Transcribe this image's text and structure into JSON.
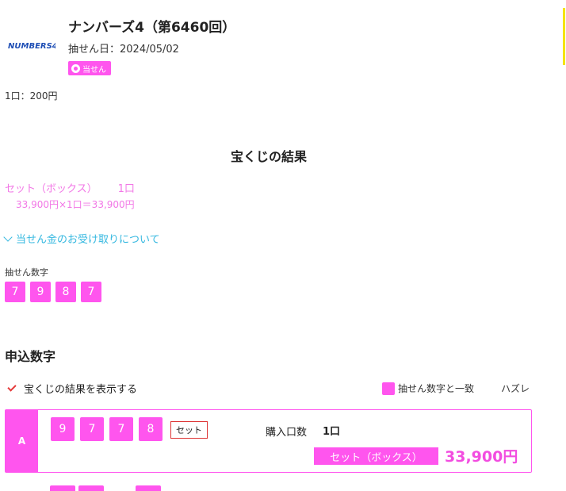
{
  "header": {
    "logo_text": "NUMBERS4",
    "title": "ナンバーズ4（第6460回）",
    "draw_date": "抽せん日：2024/05/02",
    "badge": "当せん"
  },
  "unit_price": "1口：200円",
  "result": {
    "heading": "宝くじの結果",
    "prize_type": "セット（ボックス）",
    "prize_count": "1口",
    "prize_calc": "33,900円×1口＝33,900円",
    "prize_link": "当せん金のお受け取りについて"
  },
  "winning": {
    "label": "抽せん数字",
    "digits": [
      "7",
      "9",
      "8",
      "7"
    ]
  },
  "applied": {
    "heading": "申込数字",
    "toggle_label": "宝くじの結果を表示する",
    "legend_match": "抽せん数字と一致",
    "legend_miss": "ハズレ"
  },
  "tickets": [
    {
      "label": "A",
      "digits": [
        "9",
        "7",
        "7",
        "8"
      ],
      "set_tag": "セット",
      "buy_label": "購入口数",
      "buy_value": "1口",
      "result_tag": "セット（ボックス）",
      "prize": "33,900円"
    }
  ],
  "colors": {
    "accent": "#ff55ee",
    "link": "#35b8e0",
    "prize_text": "#f277e6",
    "check": "#e53a3a"
  },
  "icons": {
    "toggle": "check-icon",
    "link": "chevron-down-icon",
    "badge": "medal-icon"
  }
}
